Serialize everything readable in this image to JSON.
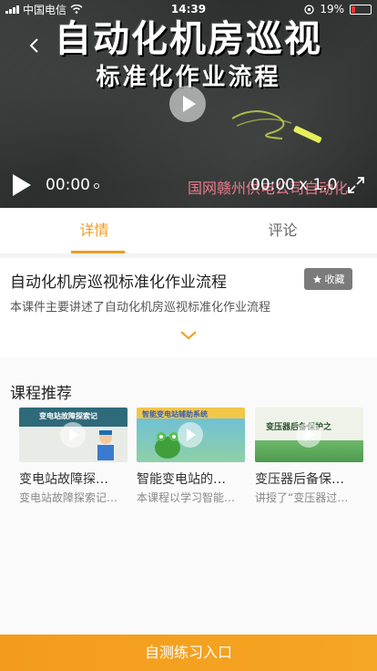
{
  "status_bar": {
    "carrier": "中国电信",
    "time": "14:39",
    "battery": "19%"
  },
  "video": {
    "title": "自动化机房巡视",
    "subtitle": "标准化作业流程",
    "current_time": "00:00",
    "duration": "00:00",
    "speed": "x 1.0",
    "watermark": "国网赣州供电公司自动化"
  },
  "tabs": [
    {
      "label": "详情",
      "active": true
    },
    {
      "label": "评论",
      "active": false
    }
  ],
  "detail": {
    "title": "自动化机房巡视标准化作业流程",
    "favorite_label": "收藏",
    "description": "本课件主要讲述了自动化机房巡视标准化作业流程"
  },
  "recommend": {
    "heading": "课程推荐",
    "items": [
      {
        "name": "变电站故障探…",
        "desc": "变电站故障探索记…",
        "thumb_text": "变电站故障探索记"
      },
      {
        "name": "智能变电站的…",
        "desc": "本课程以学习智能…",
        "thumb_text": "智能变电站辅助系统"
      },
      {
        "name": "变压器后备保…",
        "desc": "讲授了“变压器过…",
        "thumb_text": "变压器后备保护之"
      }
    ]
  },
  "bottom_button": {
    "label": "自测练习入口"
  },
  "colors": {
    "accent": "#f39a1e",
    "fav_bg": "#7b7b7b"
  }
}
